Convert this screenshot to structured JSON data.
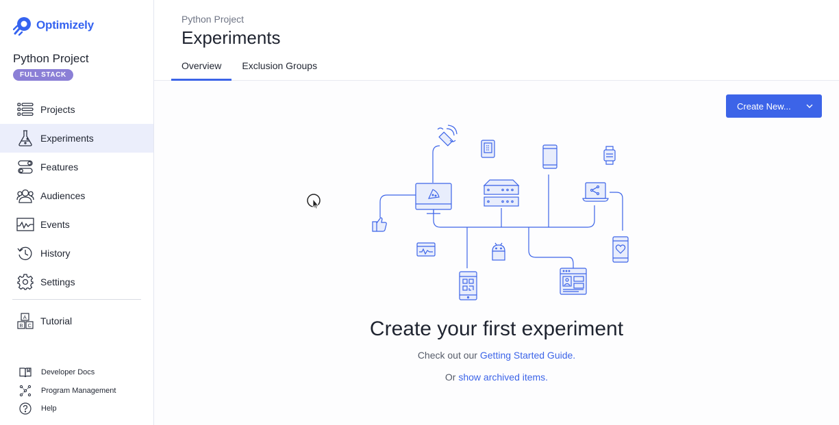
{
  "brand": {
    "name": "Optimizely",
    "color": "#3563f0"
  },
  "sidebar": {
    "project_name": "Python Project",
    "badge": "FULL STACK",
    "items": [
      {
        "label": "Projects",
        "icon": "projects-list-icon"
      },
      {
        "label": "Experiments",
        "icon": "flask-icon",
        "active": true
      },
      {
        "label": "Features",
        "icon": "toggle-icon"
      },
      {
        "label": "Audiences",
        "icon": "people-icon"
      },
      {
        "label": "Events",
        "icon": "events-chart-icon"
      },
      {
        "label": "History",
        "icon": "history-icon"
      },
      {
        "label": "Settings",
        "icon": "gear-icon"
      }
    ],
    "tutorial": {
      "label": "Tutorial",
      "icon": "abc-blocks-icon"
    },
    "footer": [
      {
        "label": "Developer Docs",
        "icon": "book-icon"
      },
      {
        "label": "Program Management",
        "icon": "network-icon"
      },
      {
        "label": "Help",
        "icon": "help-circle-icon"
      }
    ]
  },
  "header": {
    "breadcrumb": "Python Project",
    "title": "Experiments",
    "tabs": [
      {
        "label": "Overview",
        "active": true
      },
      {
        "label": "Exclusion Groups"
      }
    ]
  },
  "actions": {
    "create_label": "Create New..."
  },
  "empty_state": {
    "headline": "Create your first experiment",
    "line1_prefix": "Check out our",
    "line1_link": "Getting Started Guide.",
    "line2_prefix": "Or",
    "line2_link": "show archived items."
  },
  "colors": {
    "accent": "#3c64e8",
    "badge": "#8b7fd6",
    "active_nav": "#ebeefb"
  }
}
